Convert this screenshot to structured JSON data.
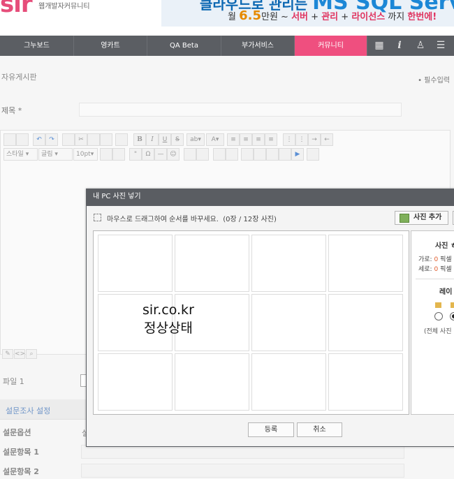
{
  "header": {
    "logo": "sir",
    "slogan": "웹개발자커뮤니티",
    "ad": {
      "headline_small": "클라우드로 관리는",
      "headline_big": "MS SQL Server",
      "line_prefix": "월",
      "price": "6.5",
      "line_unit": "만원 ~",
      "tag1": "서버",
      "plus1": "+",
      "tag2": "관리",
      "plus2": "+",
      "tag3": "라이선스",
      "line_suffix": "까지",
      "tag4": "한번에!"
    }
  },
  "nav": {
    "items": [
      {
        "label": "그누보드"
      },
      {
        "label": "영카트"
      },
      {
        "label": "QA Beta"
      },
      {
        "label": "부가서비스"
      },
      {
        "label": "커뮤니티"
      }
    ],
    "icons": [
      "grid-icon",
      "info-icon",
      "user-icon",
      "list-icon"
    ]
  },
  "page": {
    "board_title": "자유게시판",
    "required_note": "• 필수입력",
    "subject_label": "제목 *",
    "toolbar": {
      "style_select": "스타일",
      "font_select": "글림",
      "size_select": "10pt"
    },
    "file_label": "파일 1",
    "survey_header": "설문조사 설정",
    "survey_option_label": "설문옵션",
    "survey_option_value": "설",
    "survey_item1_label": "설문항목 1",
    "survey_item2_label": "설문항목 2"
  },
  "modal": {
    "title": "내 PC 사진 넣기",
    "drag_hint": "마우스로 드래그하여 순서를 바꾸세요.",
    "count_text": "(0장 / 12장 사진)",
    "add_button": "사진 추가",
    "overlay_line1": "sir.co.kr",
    "overlay_line2": "정상상태",
    "info": {
      "title": "사진 ㅎ",
      "width_label": "가로:",
      "width_value": "0",
      "width_unit": "픽셀",
      "height_label": "세로:",
      "height_value": "0",
      "height_unit": "픽셀",
      "layout_title": "레이",
      "all_photos": "(전체 사진"
    },
    "confirm_button": "등록",
    "cancel_button": "취소"
  }
}
